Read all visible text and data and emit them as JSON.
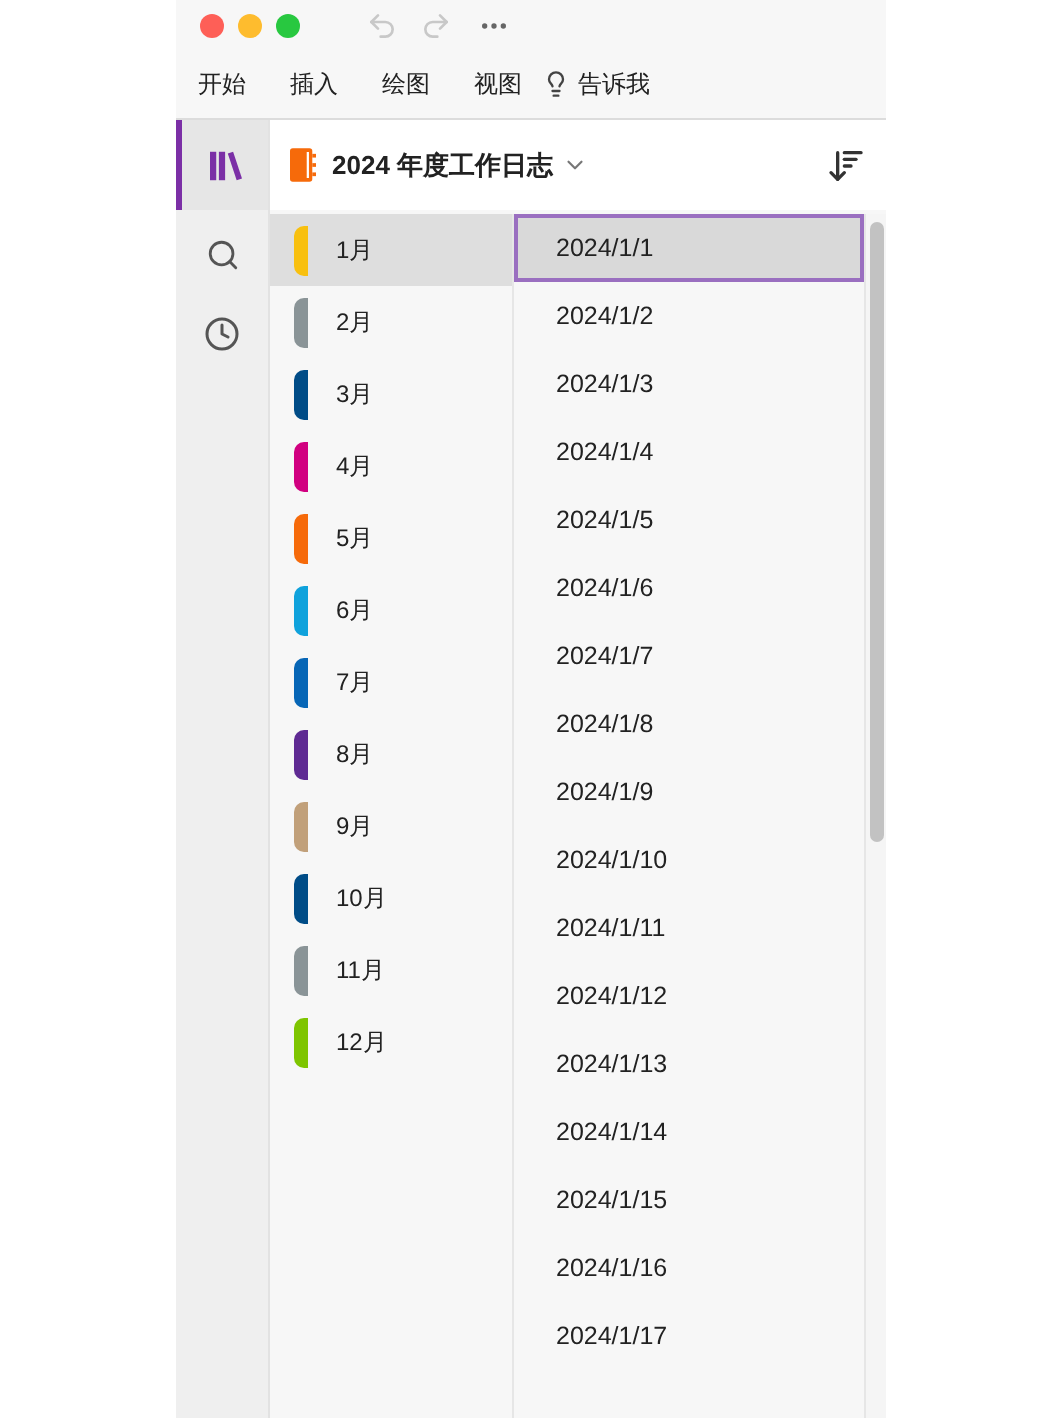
{
  "menu": [
    "开始",
    "插入",
    "绘图",
    "视图"
  ],
  "tell_me": "告诉我",
  "notebook": {
    "title": "2024 年度工作日志"
  },
  "sections": [
    {
      "label": "1月",
      "color": "#f8c00f",
      "selected": true
    },
    {
      "label": "2月",
      "color": "#8a9497",
      "selected": false
    },
    {
      "label": "3月",
      "color": "#004c87",
      "selected": false
    },
    {
      "label": "4月",
      "color": "#d10080",
      "selected": false
    },
    {
      "label": "5月",
      "color": "#f66a0a",
      "selected": false
    },
    {
      "label": "6月",
      "color": "#0fa2dc",
      "selected": false
    },
    {
      "label": "7月",
      "color": "#0766b6",
      "selected": false
    },
    {
      "label": "8月",
      "color": "#5f2a93",
      "selected": false
    },
    {
      "label": "9月",
      "color": "#c1a07a",
      "selected": false
    },
    {
      "label": "10月",
      "color": "#004c87",
      "selected": false
    },
    {
      "label": "11月",
      "color": "#8a9497",
      "selected": false
    },
    {
      "label": "12月",
      "color": "#7ec500",
      "selected": false
    }
  ],
  "pages": [
    {
      "label": "2024/1/1",
      "selected": true
    },
    {
      "label": "2024/1/2",
      "selected": false
    },
    {
      "label": "2024/1/3",
      "selected": false
    },
    {
      "label": "2024/1/4",
      "selected": false
    },
    {
      "label": "2024/1/5",
      "selected": false
    },
    {
      "label": "2024/1/6",
      "selected": false
    },
    {
      "label": "2024/1/7",
      "selected": false
    },
    {
      "label": "2024/1/8",
      "selected": false
    },
    {
      "label": "2024/1/9",
      "selected": false
    },
    {
      "label": "2024/1/10",
      "selected": false
    },
    {
      "label": "2024/1/11",
      "selected": false
    },
    {
      "label": "2024/1/12",
      "selected": false
    },
    {
      "label": "2024/1/13",
      "selected": false
    },
    {
      "label": "2024/1/14",
      "selected": false
    },
    {
      "label": "2024/1/15",
      "selected": false
    },
    {
      "label": "2024/1/16",
      "selected": false
    },
    {
      "label": "2024/1/17",
      "selected": false
    }
  ]
}
